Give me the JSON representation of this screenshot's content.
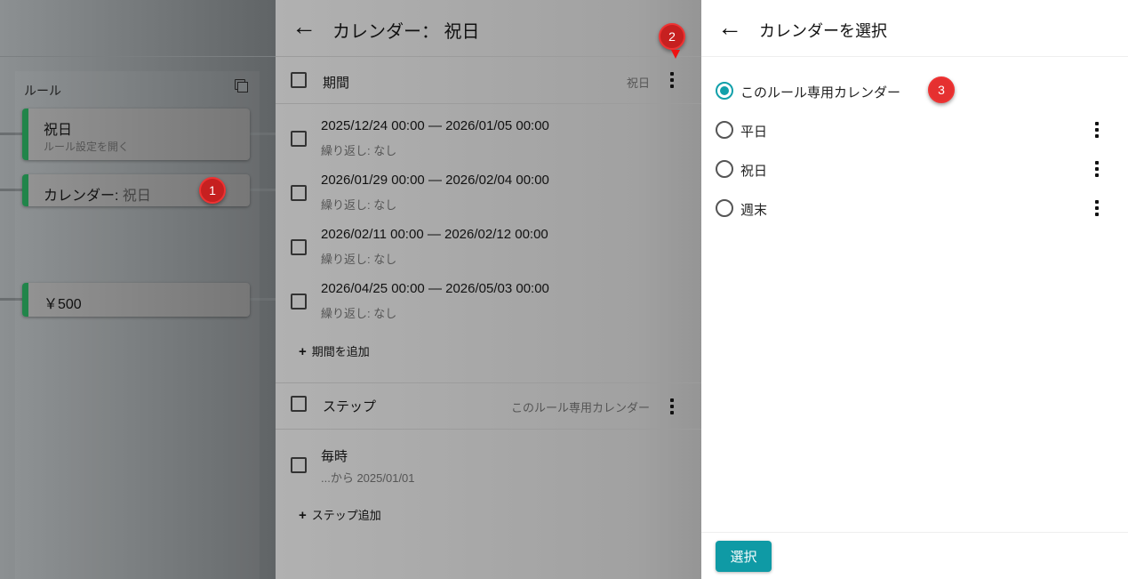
{
  "left": {
    "rules_title": "ルール",
    "cards": [
      {
        "title": "祝日",
        "subtitle": "ルール設定を開く"
      },
      {
        "title": "カレンダー: ",
        "title_value": "祝日"
      },
      {
        "title": "￥500"
      }
    ]
  },
  "annotations": [
    "1",
    "2",
    "3"
  ],
  "middle": {
    "title": "カレンダー： 祝日",
    "periods": {
      "label": "期間",
      "value": "祝日",
      "items": [
        {
          "range": "2025/12/24 00:00 — 2026/01/05 00:00",
          "repeat": "繰り返し: なし"
        },
        {
          "range": "2026/01/29 00:00 — 2026/02/04 00:00",
          "repeat": "繰り返し: なし"
        },
        {
          "range": "2026/02/11 00:00 — 2026/02/12 00:00",
          "repeat": "繰り返し: なし"
        },
        {
          "range": "2026/04/25 00:00 — 2026/05/03 00:00",
          "repeat": "繰り返し: なし"
        }
      ],
      "add_label": "期間を追加"
    },
    "steps": {
      "label": "ステップ",
      "value": "このルール専用カレンダー",
      "items": [
        {
          "title": "毎時",
          "sub": "...から 2025/01/01"
        }
      ],
      "add_label": "ステップ追加"
    }
  },
  "right": {
    "title": "カレンダーを選択",
    "options": [
      {
        "label": "このルール専用カレンダー",
        "selected": true
      },
      {
        "label": "平日"
      },
      {
        "label": "祝日"
      },
      {
        "label": "週末"
      }
    ],
    "select_button": "選択"
  },
  "colors": {
    "accent": "#0f9aa5",
    "rule_bar": "#21854a",
    "badge": "#c62020"
  }
}
